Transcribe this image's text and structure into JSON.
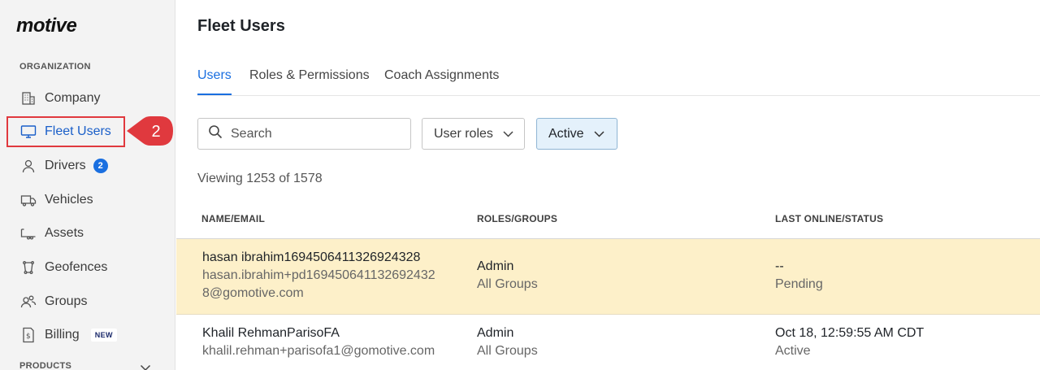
{
  "brand": {
    "logo_text": "motive"
  },
  "sidebar": {
    "organization_label": "ORGANIZATION",
    "products_label": "PRODUCTS",
    "items": [
      {
        "label": "Company",
        "icon": "building-icon"
      },
      {
        "label": "Fleet Users",
        "icon": "monitor-icon"
      },
      {
        "label": "Drivers",
        "icon": "person-icon",
        "badge": "2"
      },
      {
        "label": "Vehicles",
        "icon": "truck-icon"
      },
      {
        "label": "Assets",
        "icon": "trailer-icon"
      },
      {
        "label": "Geofences",
        "icon": "geofence-icon"
      },
      {
        "label": "Groups",
        "icon": "groups-icon"
      },
      {
        "label": "Billing",
        "icon": "billing-icon",
        "tag": "NEW"
      }
    ]
  },
  "callout": {
    "number": "2",
    "color": "#e0393e"
  },
  "main": {
    "title": "Fleet Users",
    "tabs": [
      "Users",
      "Roles & Permissions",
      "Coach Assignments"
    ],
    "search_placeholder": "Search",
    "filters": {
      "roles": "User roles",
      "status": "Active"
    },
    "viewing": "Viewing 1253 of 1578",
    "columns": [
      "NAME/EMAIL",
      "ROLES/GROUPS",
      "LAST ONLINE/STATUS"
    ],
    "rows": [
      {
        "name": "hasan ibrahim1694506411326924328",
        "email_line1": "hasan.ibrahim+pd169450641132692432",
        "email_line2": "8@gomotive.com",
        "role": "Admin",
        "groups": "All Groups",
        "last_online": "--",
        "status": "Pending"
      },
      {
        "name": "Khalil RehmanParisoFA",
        "email_line1": "khalil.rehman+parisofa1@gomotive.com",
        "role": "Admin",
        "groups": "All Groups",
        "last_online": "Oct 18, 12:59:55 AM CDT",
        "status": "Active"
      }
    ]
  },
  "colors": {
    "accent": "#1a6fe0",
    "highlight_row": "#fdf0c9",
    "active_filter_bg": "#e4f1fb"
  }
}
